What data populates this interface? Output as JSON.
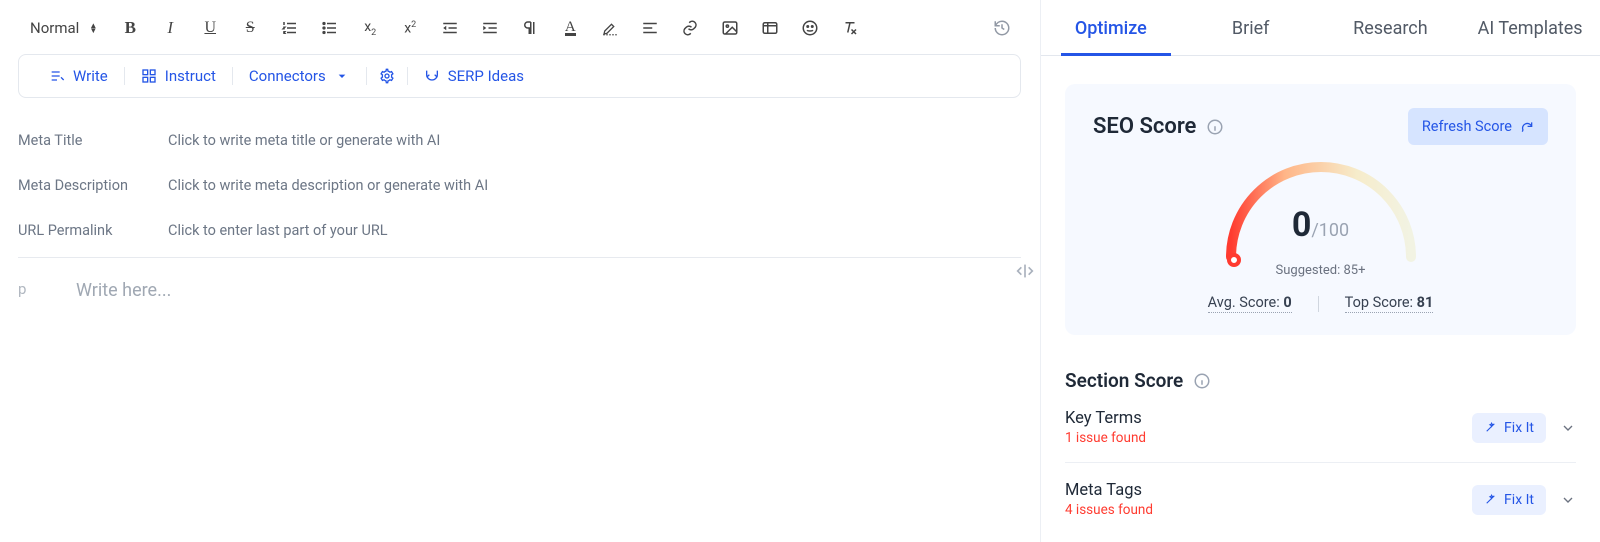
{
  "editor": {
    "style_select": "Normal",
    "meta": {
      "title_label": "Meta Title",
      "title_placeholder": "Click to write meta title or generate with AI",
      "desc_label": "Meta Description",
      "desc_placeholder": "Click to write meta description or generate with AI",
      "url_label": "URL Permalink",
      "url_placeholder": "Click to enter last part of your URL"
    },
    "gutter_tag": "p",
    "body_placeholder": "Write here..."
  },
  "ai_bar": {
    "write": "Write",
    "instruct": "Instruct",
    "connectors": "Connectors",
    "serp": "SERP Ideas"
  },
  "toolbar_icons": {
    "bold": "bold-icon",
    "italic": "italic-icon",
    "underline": "underline-icon",
    "strike": "strike-icon",
    "ol": "ordered-list-icon",
    "ul": "unordered-list-icon",
    "sub": "subscript-icon",
    "sup": "superscript-icon",
    "outdent": "outdent-icon",
    "indent": "indent-icon",
    "pilcrow": "paragraph-dir-icon",
    "colorA": "text-color-icon",
    "highlight": "highlight-icon",
    "align": "align-left-icon",
    "link": "link-icon",
    "image": "image-icon",
    "media": "media-icon",
    "emoji": "emoji-icon",
    "clear": "clear-format-icon",
    "history": "history-icon"
  },
  "panel": {
    "tabs": {
      "optimize": "Optimize",
      "brief": "Brief",
      "research": "Research",
      "ai": "AI Templates",
      "active_index": 0
    },
    "seo": {
      "title": "SEO Score",
      "refresh": "Refresh Score",
      "score_value": "0",
      "score_max": "/100",
      "suggested": "Suggested: 85+",
      "avg_label": "Avg. Score: ",
      "avg_value": "0",
      "top_label": "Top Score: ",
      "top_value": "81"
    },
    "section": {
      "title": "Section Score",
      "fix_label": "Fix It",
      "items": [
        {
          "name": "Key Terms",
          "count": "1 issue found"
        },
        {
          "name": "Meta Tags",
          "count": "4 issues found"
        }
      ]
    }
  }
}
